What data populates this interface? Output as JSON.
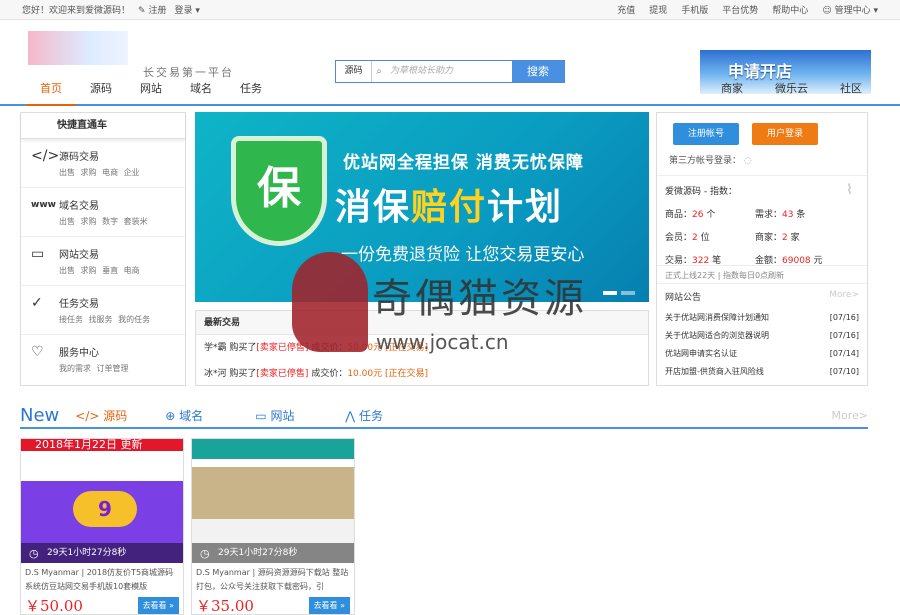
{
  "topbar": {
    "greeting": "您好！欢迎来到爱微源码！",
    "register": "注册",
    "login": "登录",
    "links": [
      "充值",
      "提现",
      "手机版",
      "平台优势",
      "帮助中心",
      "管理中心"
    ]
  },
  "header": {
    "slogan": "长交易第一平台",
    "search_category": "源码",
    "search_placeholder": "为草根站长助力",
    "search_button": "搜索",
    "ad_text": "申请开店"
  },
  "nav": {
    "items": [
      "首页",
      "源码",
      "网站",
      "域名",
      "任务"
    ],
    "right": [
      "商家",
      "微乐云",
      "社区"
    ]
  },
  "quick": {
    "title": "快捷直通车",
    "cats": [
      {
        "name": "源码交易",
        "sub": "出售 求购 电商 企业",
        "icon": "</>"
      },
      {
        "name": "域名交易",
        "sub": "出售 求购 数字 套装米",
        "icon": "www"
      },
      {
        "name": "网站交易",
        "sub": "出售 求购 垂直 电商",
        "icon": "▭"
      },
      {
        "name": "任务交易",
        "sub": "接任务 找服务 我的任务",
        "icon": "✓"
      },
      {
        "name": "服务中心",
        "sub": "我的需求 订单管理",
        "icon": "♡"
      }
    ]
  },
  "hero": {
    "line1": "优站网全程担保 消费无忧保障",
    "line2a": "消保",
    "line2b": "赔付",
    "line2c": "计划",
    "line3": "一份免费退货险 让您交易更安心",
    "shield": "保"
  },
  "trade": {
    "title": "最新交易",
    "rows": [
      {
        "user": "学*霸",
        "action": "购买了",
        "item": "[卖家已停售]",
        "amount_label": "成交价：",
        "amount": "50.00元",
        "status": "[正在交易]"
      },
      {
        "user": "冰*河",
        "action": "购买了",
        "item": "[卖家已停售]",
        "amount_label": "成交价：",
        "amount": "10.00元",
        "status": "[正在交易]"
      }
    ]
  },
  "account": {
    "register": "注册帐号",
    "login": "用户登录",
    "third": "第三方帐号登录：",
    "stats_title": "爱微源码 - 指数：",
    "stats": [
      {
        "label": "商品：",
        "value": "26",
        "unit": "个"
      },
      {
        "label": "需求：",
        "value": "43",
        "unit": "条"
      },
      {
        "label": "会员：",
        "value": "2",
        "unit": "位"
      },
      {
        "label": "商家：",
        "value": "2",
        "unit": "家"
      },
      {
        "label": "交易：",
        "value": "322",
        "unit": "笔"
      },
      {
        "label": "金额：",
        "value": "69008",
        "unit": "元"
      }
    ],
    "note": "正式上线22天 | 指数每日0点刷新"
  },
  "notice": {
    "title": "网站公告",
    "more": "More>",
    "items": [
      {
        "t": "关于优站网消费保障计划通知",
        "d": "[07/16]"
      },
      {
        "t": "关于优站网适合的浏览器说明",
        "d": "[07/16]"
      },
      {
        "t": "优站网申请实名认证",
        "d": "[07/14]"
      },
      {
        "t": "开店加盟-供货商入驻风险线",
        "d": "[07/10]"
      }
    ]
  },
  "newsec": {
    "label": "New",
    "tabs": [
      "源码",
      "域名",
      "网站",
      "任务"
    ],
    "more": "More>"
  },
  "cards": [
    {
      "banner": "2018年1月22日 更新",
      "timer": "29天1小时27分8秒",
      "title": "D.S Myanmar | 2018仿友价T5商城源码 系统仿豆站网交易手机版10套模版",
      "price": "￥50.00",
      "go": "去看看 »"
    },
    {
      "banner": "",
      "timer": "29天1小时27分8秒",
      "title": "D.S Myanmar | 源码资源源码下载站 整站打包，公众号关注获取下载密码，引",
      "price": "￥35.00",
      "go": "去看看 »"
    }
  ],
  "watermark": {
    "text": "奇偶猫资源",
    "url": "www.jocat.cn"
  }
}
